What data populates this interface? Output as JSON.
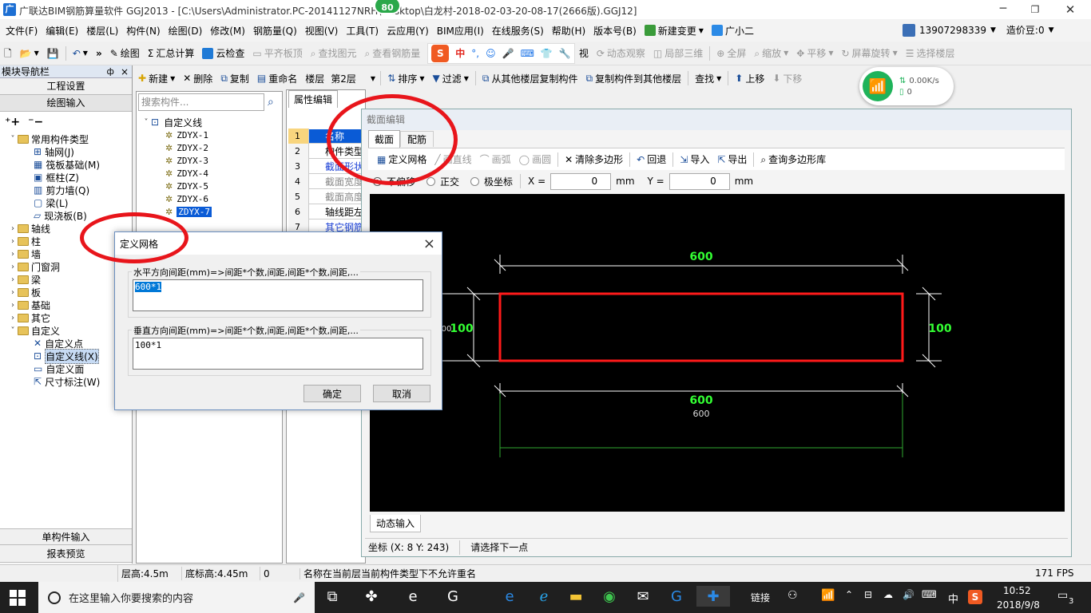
{
  "title_bar": {
    "title": "广联达BIM钢筋算量软件 GGJ2013 - [C:\\Users\\Administrator.PC-20141127NRH\\Desktop\\白龙村-2018-02-03-20-08-17(2666版).GGJ12]",
    "badge": "80"
  },
  "menu": [
    "文件(F)",
    "编辑(E)",
    "楼层(L)",
    "构件(N)",
    "绘图(D)",
    "修改(M)",
    "钢筋量(Q)",
    "视图(V)",
    "工具(T)",
    "云应用(Y)",
    "BIM应用(I)",
    "在线服务(S)",
    "帮助(H)",
    "版本号(B)",
    "新建变更",
    "广小二"
  ],
  "account": {
    "phone": "13907298339",
    "price": "造价豆:0"
  },
  "toolbar1": {
    "draw": "绘图",
    "sum": "汇总计算",
    "cloud_check": "云检查",
    "flat_top": "平齐板顶",
    "find_elem": "查找图元",
    "view_rebar": "查看钢筋量",
    "view": "视",
    "dyn_view": "动态观察",
    "local_3d": "局部三维",
    "full": "全屏",
    "zoom": "缩放",
    "pan": "平移",
    "rotate": "屏幕旋转",
    "select_floor": "选择楼层"
  },
  "toolbar2": {
    "new": "新建",
    "delete": "删除",
    "copy": "复制",
    "rename": "重命名",
    "floor_label": "楼层",
    "floor_value": "第2层",
    "sort": "排序",
    "filter": "过滤",
    "copy_from": "从其他楼层复制构件",
    "copy_to": "复制构件到其他楼层",
    "find": "查找",
    "up": "上移",
    "down": "下移"
  },
  "net_widget": {
    "speed": "0.00K/s",
    "count": "0"
  },
  "nav": {
    "title": "模块导航栏",
    "pin": "ф",
    "close": "×",
    "project_settings": "工程设置",
    "draw_input": "绘图输入",
    "single_input": "单构件输入",
    "report": "报表预览"
  },
  "tree": {
    "common_group": "常用构件类型",
    "common": [
      "轴网(J)",
      "筏板基础(M)",
      "框柱(Z)",
      "剪力墙(Q)",
      "梁(L)",
      "现浇板(B)"
    ],
    "folders": [
      "轴线",
      "柱",
      "墙",
      "门窗洞",
      "梁",
      "板",
      "基础",
      "其它",
      "自定义"
    ],
    "custom": [
      "自定义点",
      "自定义线(X)",
      "自定义面",
      "尺寸标注(W)"
    ]
  },
  "component_list": {
    "search_placeholder": "搜索构件...",
    "root": "自定义线",
    "items": [
      "ZDYX-1",
      "ZDYX-2",
      "ZDYX-3",
      "ZDYX-4",
      "ZDYX-5",
      "ZDYX-6",
      "ZDYX-7"
    ]
  },
  "property": {
    "tab": "属性编辑",
    "rows": [
      {
        "n": "1",
        "label": "名称"
      },
      {
        "n": "2",
        "label": "构件类型"
      },
      {
        "n": "3",
        "label": "截面形状"
      },
      {
        "n": "4",
        "label": "截面宽度"
      },
      {
        "n": "5",
        "label": "截面高度"
      },
      {
        "n": "6",
        "label": "轴线距左"
      },
      {
        "n": "7",
        "label": "其它钢筋"
      }
    ]
  },
  "section_editor": {
    "title": "截面编辑",
    "tabs": [
      "截面",
      "配筋"
    ],
    "tools": {
      "define_grid": "定义网格",
      "line": "画直线",
      "arc": "画弧",
      "circle": "画圆",
      "clear": "清除多边形",
      "undo": "回退",
      "import": "导入",
      "export": "导出",
      "query": "查询多边形库"
    },
    "coords": {
      "no_offset": "不偏移",
      "ortho": "正交",
      "polar": "极坐标",
      "x_label": "X =",
      "x_value": "0",
      "y_label": "Y =",
      "y_value": "0",
      "unit": "mm"
    },
    "dims": {
      "top": "600",
      "bottom": "600",
      "bottom_small": "600",
      "left": "100",
      "left_small": "00",
      "right": "100"
    },
    "dynamic_input": "动态输入",
    "status_coord": "坐标 (X: 8 Y: 243)",
    "status_msg": "请选择下一点"
  },
  "dialog": {
    "title": "定义网格",
    "close": "×",
    "h_label": "水平方向间距(mm)=>间距*个数,间距,间距*个数,间距,...",
    "h_value": "600*1",
    "v_label": "垂直方向间距(mm)=>间距*个数,间距,间距*个数,间距,...",
    "v_value": "100*1",
    "ok": "确定",
    "cancel": "取消"
  },
  "status": {
    "floor_h": "层高:4.5m",
    "base_h": "底标高:4.45m",
    "num": "0",
    "msg": "名称在当前层当前构件类型下不允许重名",
    "fps": "171 FPS"
  },
  "taskbar": {
    "search": "在这里输入你要搜索的内容",
    "link": "链接",
    "ime": "中",
    "time": "10:52",
    "date": "2018/9/8",
    "notif": "3"
  },
  "colors": {
    "accent": "#0078d7",
    "canvas": "#000000",
    "dim_green": "#33ff33",
    "rect_red": "#ff1a1a"
  }
}
